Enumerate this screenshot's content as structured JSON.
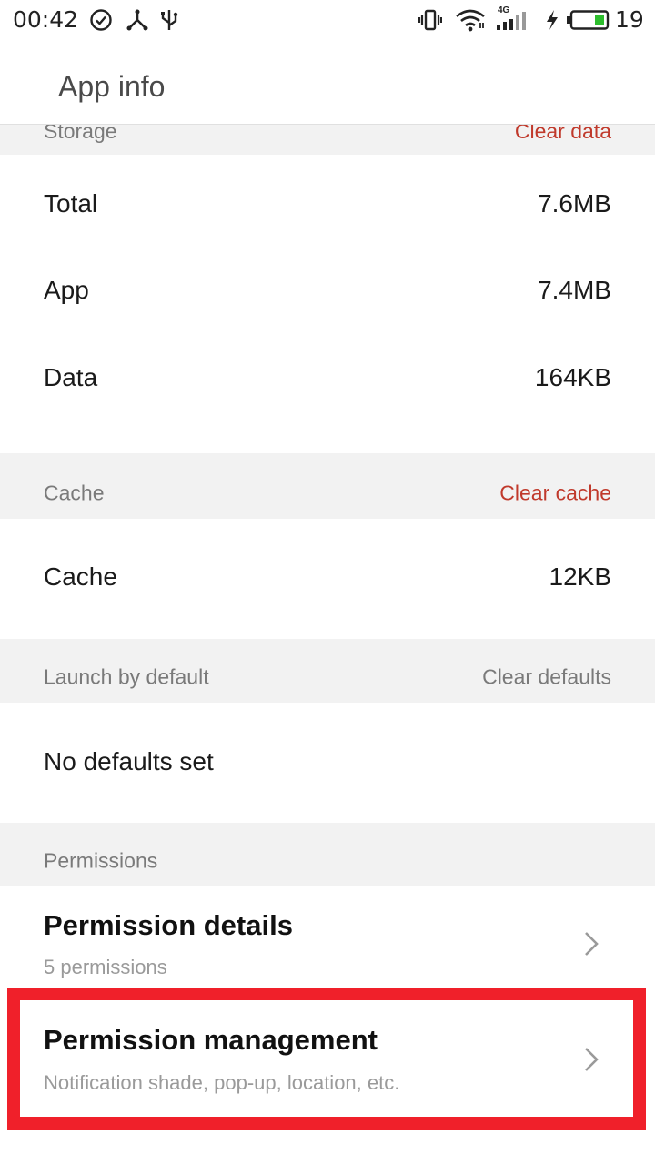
{
  "status_bar": {
    "time": "00:42",
    "battery_percent": "19",
    "icons": [
      "check-circle-icon",
      "network-share-icon",
      "usb-icon",
      "vibrate-icon",
      "wifi-icon",
      "4g-signal-icon",
      "charging-icon",
      "battery-icon"
    ],
    "network_label": "4G"
  },
  "appbar": {
    "title": "App info"
  },
  "storage": {
    "header": "Storage",
    "action": "Clear data",
    "rows": [
      {
        "label": "Total",
        "value": "7.6MB"
      },
      {
        "label": "App",
        "value": "7.4MB"
      },
      {
        "label": "Data",
        "value": "164KB"
      }
    ]
  },
  "cache": {
    "header": "Cache",
    "action": "Clear cache",
    "row": {
      "label": "Cache",
      "value": "12KB"
    }
  },
  "launch": {
    "header": "Launch by default",
    "action": "Clear defaults",
    "row": {
      "label": "No defaults set"
    }
  },
  "permissions": {
    "header": "Permissions",
    "details": {
      "title": "Permission details",
      "subtitle": "5 permissions"
    },
    "management": {
      "title": "Permission management",
      "subtitle": "Notification shade, pop-up, location, etc."
    }
  },
  "colors": {
    "accent_red": "#c0392b",
    "highlight_red": "#f0202a",
    "section_bg": "#f2f2f2"
  }
}
